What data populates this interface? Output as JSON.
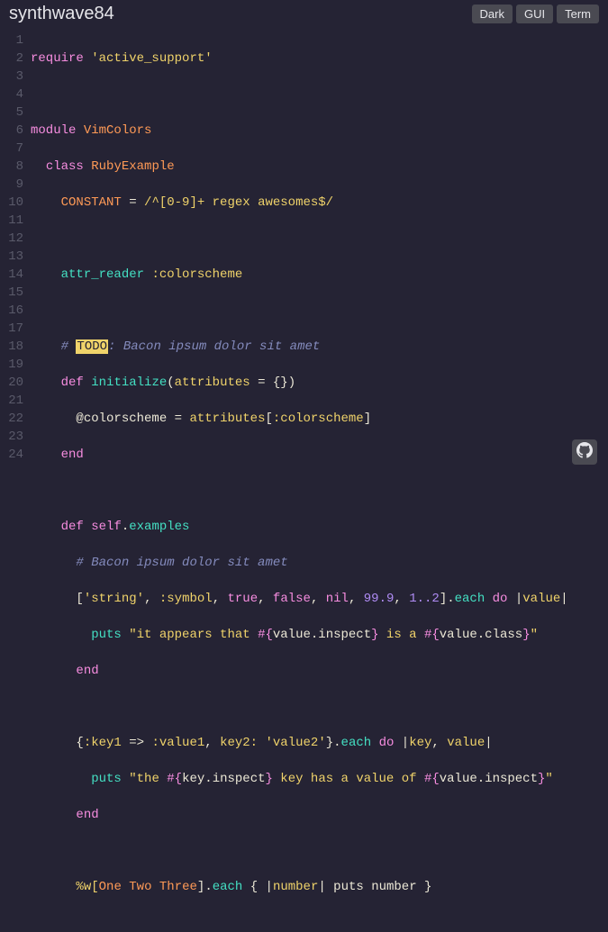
{
  "header": {
    "title": "synthwave84",
    "buttons": {
      "dark": "Dark",
      "gui": "GUI",
      "term": "Term"
    }
  },
  "gutter": [
    "1",
    "2",
    "3",
    "4",
    "5",
    "6",
    "7",
    "8",
    "9",
    "10",
    "11",
    "12",
    "13",
    "14",
    "15",
    "16",
    "17",
    "18",
    "19",
    "20",
    "21",
    "22",
    "23",
    "24"
  ],
  "t": {
    "require": "require",
    "sq": "'",
    "active_support": "active_support",
    "module": "module",
    "VimColors": "VimColors",
    "class": "class",
    "RubyExample": "RubyExample",
    "CONSTANT": "CONSTANT",
    "eq": " = ",
    "regex": "/^[0-9]+ regex awesomes$/",
    "attr_reader": "attr_reader",
    "colorscheme_sym": ":colorscheme",
    "hash": "# ",
    "TODO": "TODO",
    "todo_rest": ": Bacon ipsum dolor sit amet",
    "def": "def",
    "initialize": "initialize",
    "lparen": "(",
    "attributes": "attributes",
    "eq2": " = ",
    "emptyhash": "{}",
    "rparen": ")",
    "ivar_cs": "@colorscheme",
    "attributes2": "attributes",
    "lbr": "[",
    "rbr": "]",
    "end": "end",
    "self": "self",
    "dot": ".",
    "examples": "examples",
    "comment2": "# Bacon ipsum dolor sit amet",
    "string_lit": "string",
    "comma": ", ",
    "symbol_sym": ":symbol",
    "true": "true",
    "false": "false",
    "nil": "nil",
    "n99": "99.9",
    "range": "1..2",
    "each": "each",
    "do": "do",
    "pipe": "|",
    "value": "value",
    "puts": "puts",
    "dq": "\"",
    "it_appears": "it appears that ",
    "interp_o": "#{",
    "interp_c": "}",
    "inspect": "inspect",
    "is_a": " is a ",
    "class_word": "class",
    "key1_sym": ":key1",
    "fatarrow": " => ",
    "value1_sym": ":value1",
    "key2": "key2:",
    "value2_lit": "value2",
    "brace_o": "{",
    "brace_c": "}",
    "key": "key",
    "the": "the ",
    "key_has": " key has a value of ",
    "pctw": "%w[",
    "One": "One",
    "Two": "Two",
    "Three": "Three",
    "sp": " ",
    "each2": "each",
    "number": "number",
    "puts_number": " puts number "
  }
}
